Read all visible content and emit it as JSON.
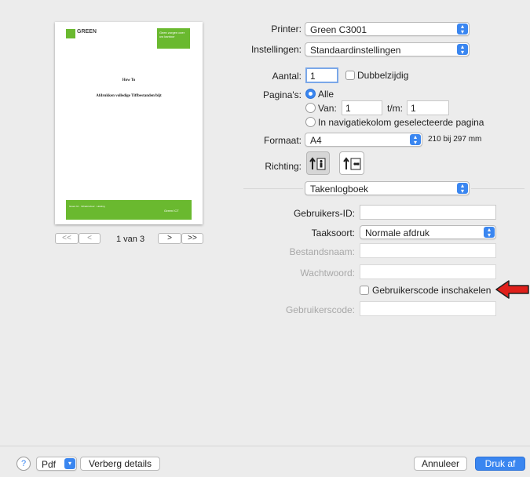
{
  "preview": {
    "brand_text": "GREEN",
    "header_box_text": "Geen zorgen over uw kantoor",
    "doc_title": "How To",
    "doc_subtitle": "Afdrukken volledige Tiffbestanden/bijt",
    "footer_left": "Green Ict · Infrastructuur · Hosting",
    "footer_right": "Green ICT",
    "page_indicator": "1 van 3",
    "nav_first": "<<",
    "nav_prev": "<",
    "nav_next": ">",
    "nav_last": ">>",
    "brand_color": "#6ab92f"
  },
  "printer": {
    "label": "Printer:",
    "value": "Green C3001"
  },
  "presets": {
    "label": "Instellingen:",
    "value": "Standaardinstellingen"
  },
  "copies": {
    "label": "Aantal:",
    "value": "1",
    "duplex_label": "Dubbelzijdig"
  },
  "pages": {
    "label": "Pagina's:",
    "all_label": "Alle",
    "from_label": "Van:",
    "from_value": "1",
    "to_label": "t/m:",
    "to_value": "1",
    "selected_label": "In navigatiekolom geselecteerde pagina"
  },
  "paper": {
    "label": "Formaat:",
    "value": "A4",
    "dimensions": "210 bij 297 mm"
  },
  "orientation": {
    "label": "Richting:"
  },
  "section": {
    "value": "Takenlogboek"
  },
  "job_log": {
    "user_id_label": "Gebruikers-ID:",
    "user_id_value": "",
    "job_type_label": "Taaksoort:",
    "job_type_value": "Normale afdruk",
    "filename_label": "Bestandsnaam:",
    "password_label": "Wachtwoord:",
    "usercode_enable_label": "Gebruikerscode inschakelen",
    "usercode_label": "Gebruikerscode:"
  },
  "footer": {
    "help": "?",
    "pdf": "Pdf",
    "hide_details": "Verberg details",
    "cancel": "Annuleer",
    "print": "Druk af"
  },
  "colors": {
    "accent": "#3a86f0",
    "annotation_arrow": "#e0201b"
  }
}
